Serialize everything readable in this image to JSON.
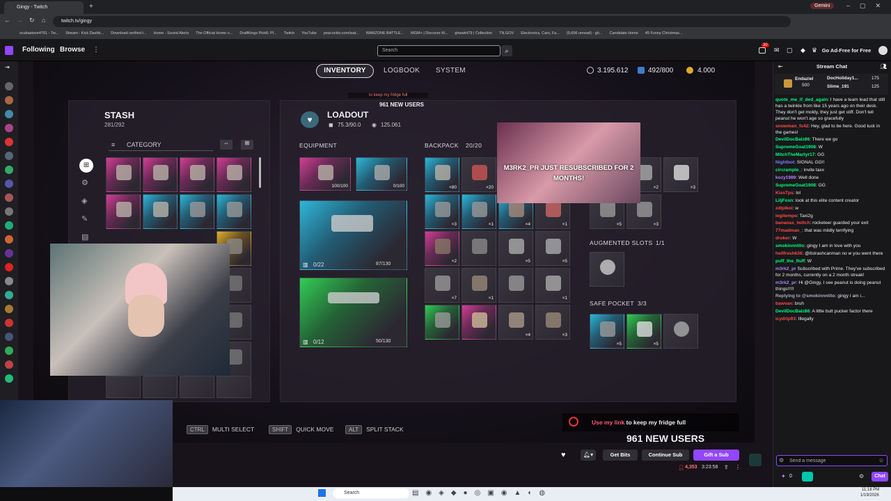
{
  "browser": {
    "tab_title": "Gingy - Twitch",
    "url": "twitch.tv/gingy",
    "profile_badge": "Gemini",
    "bookmarks": [
      "scubasteve4761 - Tw...",
      "Stream - Kick Dashb...",
      "Download verified t...",
      "Home - Sound Alerts",
      "The Official Home o...",
      "DraftKings Pick6: Pl...",
      "Twitch",
      "YouTube",
      "peacocktv.com/wat...",
      "WARZONE BATTLE...",
      "MGM+ | Discover M...",
      "ghawk479 | Collection",
      "TN.GOV",
      "Electronics, Cars, Fa...",
      "(9,606 unread) - gh...",
      "Candidate Home",
      "45 Funny Christmas..."
    ]
  },
  "twitch_nav": {
    "following": "Following",
    "browse": "Browse",
    "search_placeholder": "Search",
    "notif_count": "30",
    "ad_free": "Go Ad-Free for Free"
  },
  "game": {
    "tabs": [
      "INVENTORY",
      "LOGBOOK",
      "SYSTEM"
    ],
    "currency": {
      "coins": "3.195.612",
      "capacity": "492/800",
      "gold": "4.000"
    },
    "stash": {
      "title": "STASH",
      "count": "281/292",
      "category": "CATEGORY"
    },
    "loadout": {
      "title": "LOADOUT",
      "weight": "75.3/90.0",
      "value": "125.061"
    },
    "equipment": {
      "label": "EQUIPMENT",
      "shield": "100/100",
      "augment": "0/100",
      "weapon1_ammo": "0/22",
      "weapon1_dur": "87/130",
      "weapon2_ammo": "0/12",
      "weapon2_dur": "50/130"
    },
    "backpack": {
      "label": "BACKPACK",
      "count": "20/20",
      "qtys": [
        "×80",
        "×20",
        "×3",
        "×1",
        "×4",
        "×1",
        "×2",
        "×5",
        "×5",
        "×7",
        "×1",
        "×1",
        "×4",
        "×3"
      ]
    },
    "right_qtys": [
      "×2",
      "×3",
      "×5",
      "×3"
    ],
    "augmented_slots": {
      "label": "AUGMENTED SLOTS",
      "count": "1/1"
    },
    "safe_pocket": {
      "label": "SAFE POCKET",
      "count": "3/3",
      "qtys": [
        "×5",
        "×5"
      ]
    },
    "hints": [
      {
        "key": "CTRL",
        "label": "MULTI SELECT"
      },
      {
        "key": "SHIFT",
        "label": "QUICK MOVE"
      },
      {
        "key": "ALT",
        "label": "SPLIT STACK"
      }
    ],
    "goal_small": "to keep my fridge full",
    "goal_small_users": "961 NEW USERS"
  },
  "overlay": {
    "sub_alert": "M3RK2_PR JUST RESUBSCRIBED FOR 2 MONTHS!",
    "goal_text_link": "Use my link",
    "goal_text_rest": " to keep my fridge full",
    "goal_users": "961 NEW USERS"
  },
  "player": {
    "get_bits": "Get Bits",
    "continue_sub": "Continue Sub",
    "gift_sub": "Gift a Sub",
    "viewers": "4,353",
    "uptime": "3:23:58"
  },
  "chat": {
    "header": "Stream Chat",
    "pinned": [
      {
        "name": "Endaziel",
        "value": "500"
      },
      {
        "name": "DocHoliday1...",
        "value": "175"
      },
      {
        "name": "Slime_191",
        "value": "125"
      }
    ],
    "messages": [
      {
        "user": "quote_me_if_ded_again",
        "color": "#00ff7f",
        "text": ": I have a team lead that still has a twinkle from like 15 years ago on their desk. They don't get moldy, they just get stiff. Don't tell peanut he won't age so gracefully"
      },
      {
        "user": "snowman_fs42",
        "color": "#ff4a4a",
        "text": ": Hey, glad to be here. Good luck in the games!"
      },
      {
        "user": "DevilDocBalz86",
        "color": "#00ff7f",
        "text": ": There we go"
      },
      {
        "user": "SupremeGoat1908",
        "color": "#00ff7f",
        "text": ": W"
      },
      {
        "user": "MitchTheMartyr17",
        "color": "#00ff7f",
        "text": ": GG"
      },
      {
        "user": "Nightbot",
        "color": "#7c7cff",
        "text": ": SIGNAL GG!!"
      },
      {
        "user": "circrample_",
        "color": "#00ff7f",
        "text": ": invite taxx"
      },
      {
        "user": "kozy1989",
        "color": "#b086ff",
        "text": ": Well done"
      },
      {
        "user": "SupremeGoat1908",
        "color": "#00ff7f",
        "text": ": GG"
      },
      {
        "user": "KissTps",
        "color": "#ff4a4a",
        "text": ": lol"
      },
      {
        "user": "LiljFoxn",
        "color": "#00ff7f",
        "text": ": look at this elite content creator"
      },
      {
        "user": "zdlplkoi",
        "color": "#ff4a4a",
        "text": ": w"
      },
      {
        "user": "legitempo",
        "color": "#ff4a4a",
        "text": ": Taxi2g"
      },
      {
        "user": "bananas_twitch",
        "color": "#ff4a4a",
        "text": ": rocketeer guarded your exit"
      },
      {
        "user": "77madman_",
        "color": "#ff4a4a",
        "text": ": that was mildly terrifying"
      },
      {
        "user": "droker",
        "color": "#ff4a4a",
        "text": ": W"
      },
      {
        "user": "smokinnntito",
        "color": "#00ff7f",
        "text": ": gingy I am in love with you"
      },
      {
        "user": "hellfresh636",
        "color": "#ff4a4a",
        "text": ": @itstrashcanman no w you went there"
      },
      {
        "user": "puff_the_fluff",
        "color": "#00ff7f",
        "text": ": W"
      },
      {
        "user": "m3rk2_pr",
        "color": "#b086ff",
        "text": " Subscribed with Prime. They've subscribed for 2 months, currently on a 2 month streak!"
      },
      {
        "user": "m3rk2_pr",
        "color": "#b086ff",
        "text": ": Hi @Gingy, I see peanut is doing peanut things!!!!!"
      },
      {
        "user": "Replying to @smokinnntito",
        "color": "#adadb8",
        "text": ": gingy I am i..."
      },
      {
        "user": "bawvan",
        "color": "#ff4a4a",
        "text": ": bruh"
      },
      {
        "user": "DevilDocBalz86",
        "color": "#00ff7f",
        "text": ": A little butt pucker factor there"
      },
      {
        "user": "icydrip93",
        "color": "#ff4a4a",
        "text": ": Illegally"
      }
    ],
    "input_placeholder": "Send a message",
    "points": "0",
    "chat_button": "Chat"
  },
  "taskbar": {
    "search": "Search",
    "time": "11:18 PM",
    "date": "1/19/2026"
  }
}
